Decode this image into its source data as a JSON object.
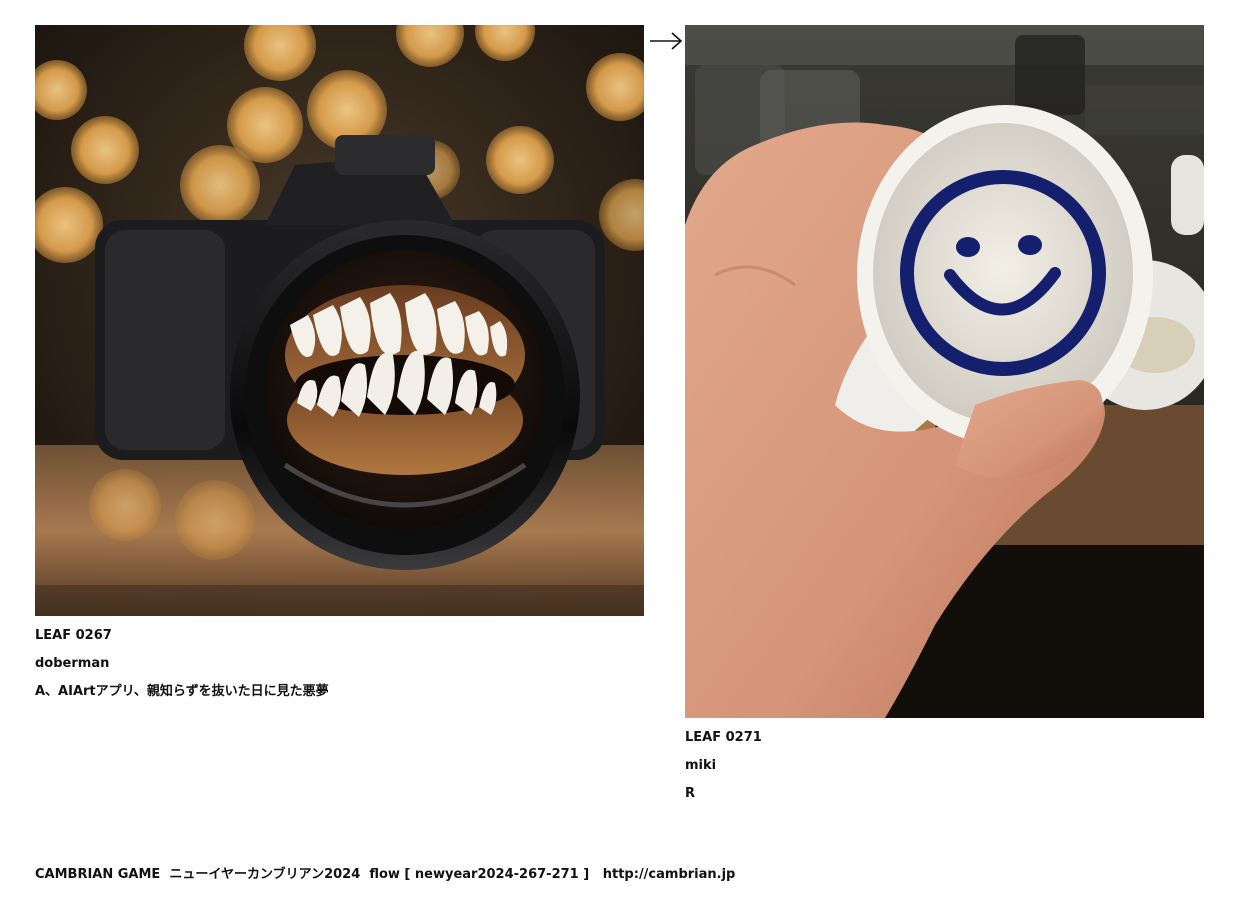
{
  "leaf_a": {
    "id": "LEAF 0267",
    "author": "doberman",
    "caption": "A、AIArtアプリ、親知らずを抜いた日に見た悪夢",
    "image": "camera-with-teeth-photo"
  },
  "arrow": "right-arrow-icon",
  "leaf_b": {
    "id": "LEAF 0271",
    "author": "miki",
    "caption": "R",
    "image": "smiley-sake-cup-photo"
  },
  "footer": {
    "brand": "CAMBRIAN GAME",
    "title": "ニューイヤーカンブリアン2024",
    "flow": "flow [ newyear2024-267-271 ]",
    "url": "http://cambrian.jp"
  },
  "colors": {
    "text": "#111111",
    "background": "#ffffff",
    "bokeh": "#f0b45a",
    "smiley_blue": "#14206e"
  }
}
